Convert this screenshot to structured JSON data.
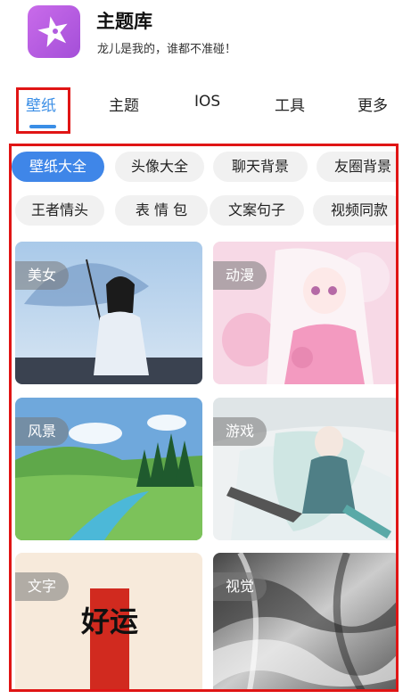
{
  "header": {
    "app_icon": "star-icon",
    "title": "主题库",
    "subtitle": "龙儿是我的，谁都不准碰！"
  },
  "tabs": [
    {
      "label": "壁纸",
      "active": true
    },
    {
      "label": "主题",
      "active": false
    },
    {
      "label": "IOS",
      "active": false
    },
    {
      "label": "工具",
      "active": false
    },
    {
      "label": "更多",
      "active": false
    }
  ],
  "categories": [
    {
      "label": "壁纸大全",
      "active": true
    },
    {
      "label": "头像大全",
      "active": false
    },
    {
      "label": "聊天背景",
      "active": false
    },
    {
      "label": "友圈背景",
      "active": false
    },
    {
      "label": "王者情头",
      "active": false
    },
    {
      "label": "表 情 包",
      "active": false
    },
    {
      "label": "文案句子",
      "active": false
    },
    {
      "label": "视频同款",
      "active": false
    }
  ],
  "cards": [
    {
      "label": "美女"
    },
    {
      "label": "动漫"
    },
    {
      "label": "风景"
    },
    {
      "label": "游戏"
    },
    {
      "label": "文字",
      "art_text": "好运"
    },
    {
      "label": "视觉"
    }
  ],
  "colors": {
    "accent": "#3a8ee6",
    "highlight_border": "#e01515",
    "chip_active": "#3f86e8",
    "chip_inactive": "#f1f1f1"
  }
}
